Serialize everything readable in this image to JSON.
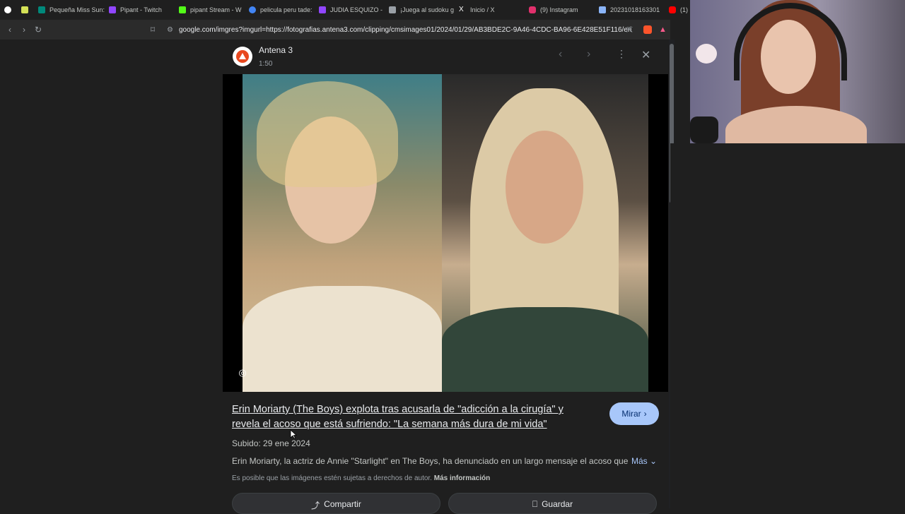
{
  "tabs": [
    {
      "label": "",
      "color": "#ffffff"
    },
    {
      "label": "",
      "color": "#d4e157"
    },
    {
      "label": "Pequeña Miss Sun:",
      "color": "#00897b"
    },
    {
      "label": "Pipant - Twitch",
      "color": "#9146ff"
    },
    {
      "label": "pipant Stream - W",
      "color": "#53fc18"
    },
    {
      "label": "pelicula peru tade:",
      "color": "#4285f4"
    },
    {
      "label": "JUDIA ESQUIZO -",
      "color": "#9146ff"
    },
    {
      "label": "¡Juega al sudoku g",
      "color": "#9aa0a6"
    },
    {
      "label": "Inicio / X",
      "color": "#ffffff"
    },
    {
      "label": "(9) Instagram",
      "color": "#e1306c"
    },
    {
      "label": "20231018163301",
      "color": "#8ab4f8"
    },
    {
      "label": "(1)",
      "color": "#ff0000"
    }
  ],
  "toolbar": {
    "url": "google.com/imgres?imgurl=https://fotografias.antena3.com/clipping/cmsimages01/2024/01/29/AB3BDE2C-9A46-4CDC-BA96-6E428E51F116/erin-m..."
  },
  "panel": {
    "source_name": "Antena 3",
    "source_sub": "1:50",
    "title": "Erin Moriarty (The Boys) explota tras acusarla de \"adicción a la cirugía\" y revela el acoso que está sufriendo: \"La semana más dura de mi vida\"",
    "mirar_label": "Mirar",
    "date": "Subido: 29 ene 2024",
    "description": "Erin Moriarty, la actriz de Annie \"Starlight\" en The Boys, ha denunciado en un largo mensaje el acoso que…",
    "more_label": "Más",
    "rights_text": "Es posible que las imágenes estén sujetas a derechos de autor.",
    "rights_link": "Más información",
    "share_label": "Compartir",
    "save_label": "Guardar"
  },
  "colors": {
    "accent": "#a8c7fa",
    "background": "#1f1f1f"
  }
}
